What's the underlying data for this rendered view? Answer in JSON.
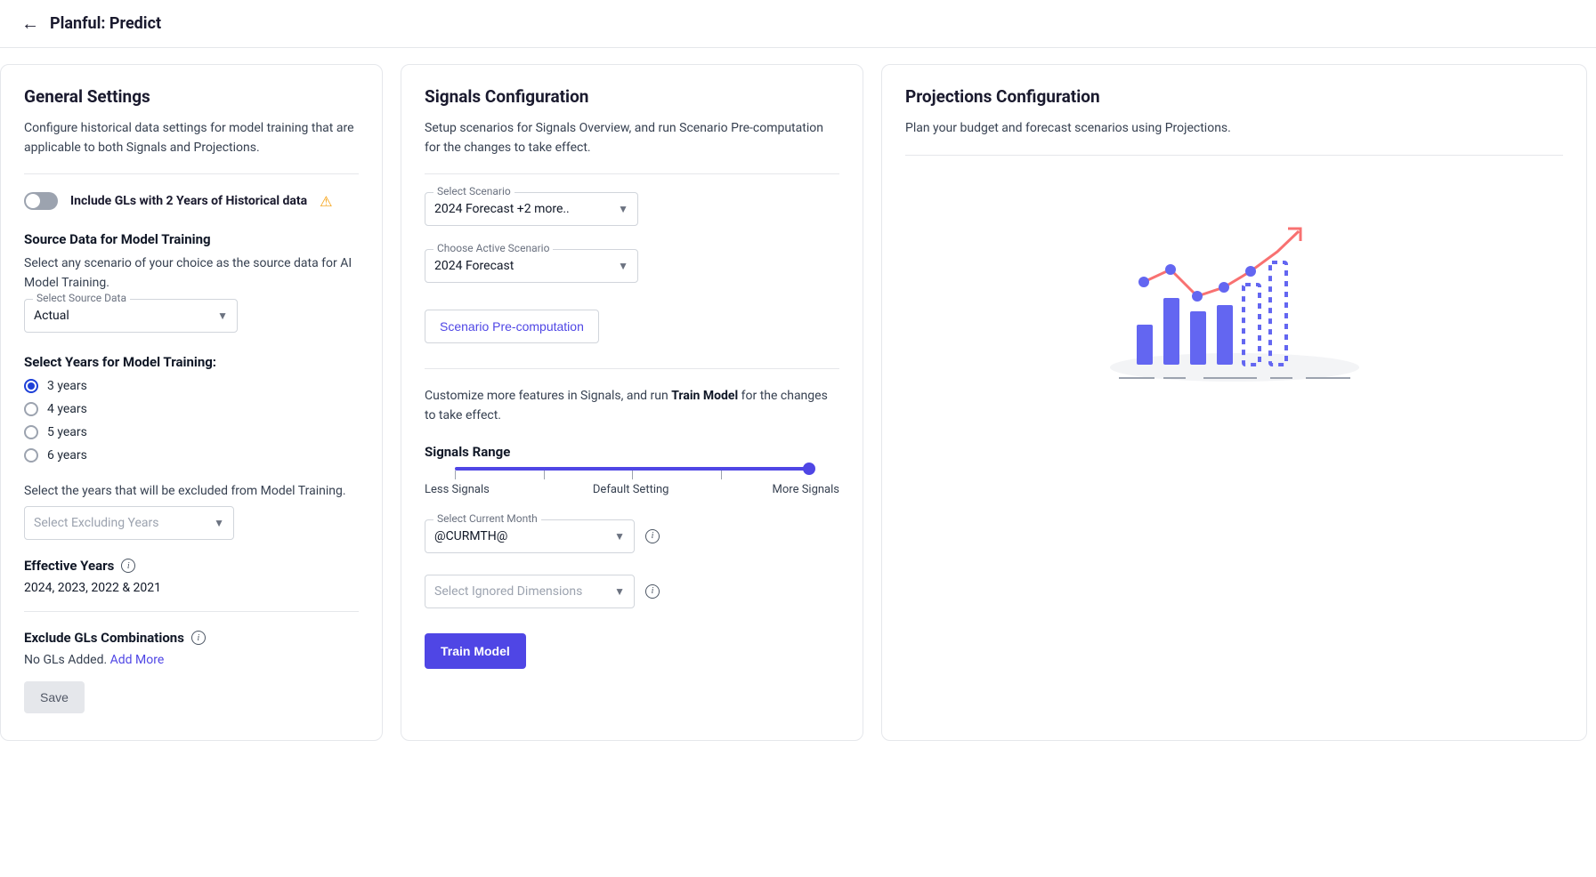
{
  "header": {
    "title": "Planful: Predict"
  },
  "general": {
    "title": "General Settings",
    "desc": "Configure historical data settings for model training that are applicable to both Signals and Projections.",
    "toggle_label": "Include GLs with 2 Years of Historical data",
    "source_title": "Source Data for Model Training",
    "source_desc": "Select any scenario of your choice as the source data for AI Model Training.",
    "source_select_label": "Select Source Data",
    "source_select_value": "Actual",
    "years_title": "Select Years for Model Training:",
    "years_options": [
      "3 years",
      "4 years",
      "5 years",
      "6 years"
    ],
    "years_selected_index": 0,
    "exclude_desc": "Select the years that will be excluded from Model Training.",
    "exclude_placeholder": "Select Excluding Years",
    "effective_label": "Effective Years",
    "effective_value": "2024, 2023, 2022 & 2021",
    "exclude_gls_title": "Exclude GLs Combinations",
    "exclude_gls_none": "No GLs Added.",
    "add_more": "Add More",
    "save": "Save"
  },
  "signals": {
    "title": "Signals Configuration",
    "desc": "Setup scenarios for Signals Overview, and run Scenario Pre-computation for the changes to take effect.",
    "select_scenario_label": "Select Scenario",
    "select_scenario_value": "2024 Forecast  +2 more..",
    "active_scenario_label": "Choose Active Scenario",
    "active_scenario_value": "2024 Forecast",
    "precompute_btn": "Scenario Pre-computation",
    "desc2_pre": "Customize more features in Signals, and run ",
    "desc2_bold": "Train Model",
    "desc2_post": " for the changes to take effect.",
    "range_title": "Signals Range",
    "slider_labels": [
      "Less Signals",
      "Default Setting",
      "More Signals"
    ],
    "current_month_label": "Select Current Month",
    "current_month_value": "@CURMTH@",
    "ignored_dim_placeholder": "Select Ignored Dimensions",
    "train_btn": "Train Model"
  },
  "projections": {
    "title": "Projections Configuration",
    "desc": "Plan your budget and forecast scenarios using Projections."
  }
}
